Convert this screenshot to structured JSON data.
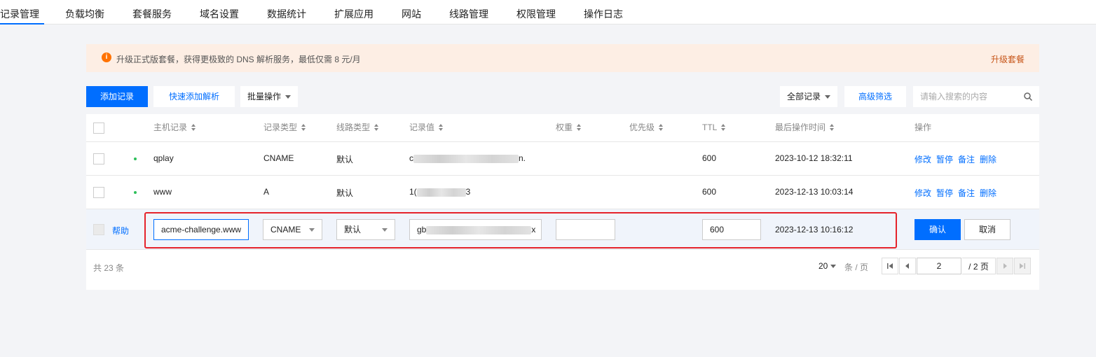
{
  "tabs": [
    "记录管理",
    "负载均衡",
    "套餐服务",
    "域名设置",
    "数据统计",
    "扩展应用",
    "网站",
    "线路管理",
    "权限管理",
    "操作日志"
  ],
  "active_tab_index": 0,
  "notice": {
    "icon": "info-icon",
    "text": "升级正式版套餐，获得更极致的 DNS 解析服务，最低仅需 8 元/月",
    "link": "升级套餐",
    "accent": "#ff7200"
  },
  "toolbar": {
    "add_record": "添加记录",
    "quick_add": "快速添加解析",
    "batch": "批量操作",
    "record_filter": "全部记录",
    "advanced_filter": "高级筛选",
    "search_placeholder": "请输入搜索的内容"
  },
  "table": {
    "columns": [
      "主机记录",
      "记录类型",
      "线路类型",
      "记录值",
      "权重",
      "优先级",
      "TTL",
      "最后操作时间",
      "操作"
    ],
    "rows": [
      {
        "host": "qplay",
        "type": "CNAME",
        "line": "默认",
        "value_prefix": "c",
        "value_suffix": "n.",
        "weight": "",
        "priority": "",
        "ttl": "600",
        "time": "2023-10-12 18:32:11",
        "status_color": "#2dbf5a"
      },
      {
        "host": "www",
        "type": "A",
        "line": "默认",
        "value_prefix": "1(",
        "value_suffix": "3",
        "weight": "",
        "priority": "",
        "ttl": "600",
        "time": "2023-12-13 10:03:14",
        "status_color": "#2dbf5a"
      }
    ],
    "actions": [
      "修改",
      "暂停",
      "备注",
      "删除"
    ],
    "edit_row": {
      "help": "帮助",
      "host": "acme-challenge.www",
      "type": "CNAME",
      "line": "默认",
      "value_prefix": "gb",
      "value_suffix": "x",
      "weight": "",
      "ttl": "600",
      "time": "2023-12-13 10:16:12",
      "confirm": "确认",
      "cancel": "取消"
    }
  },
  "footer": {
    "total": "共 23 条",
    "page_size": "20",
    "page_size_unit": "条 / 页",
    "page_input": "2",
    "page_total": "/ 2 页"
  }
}
